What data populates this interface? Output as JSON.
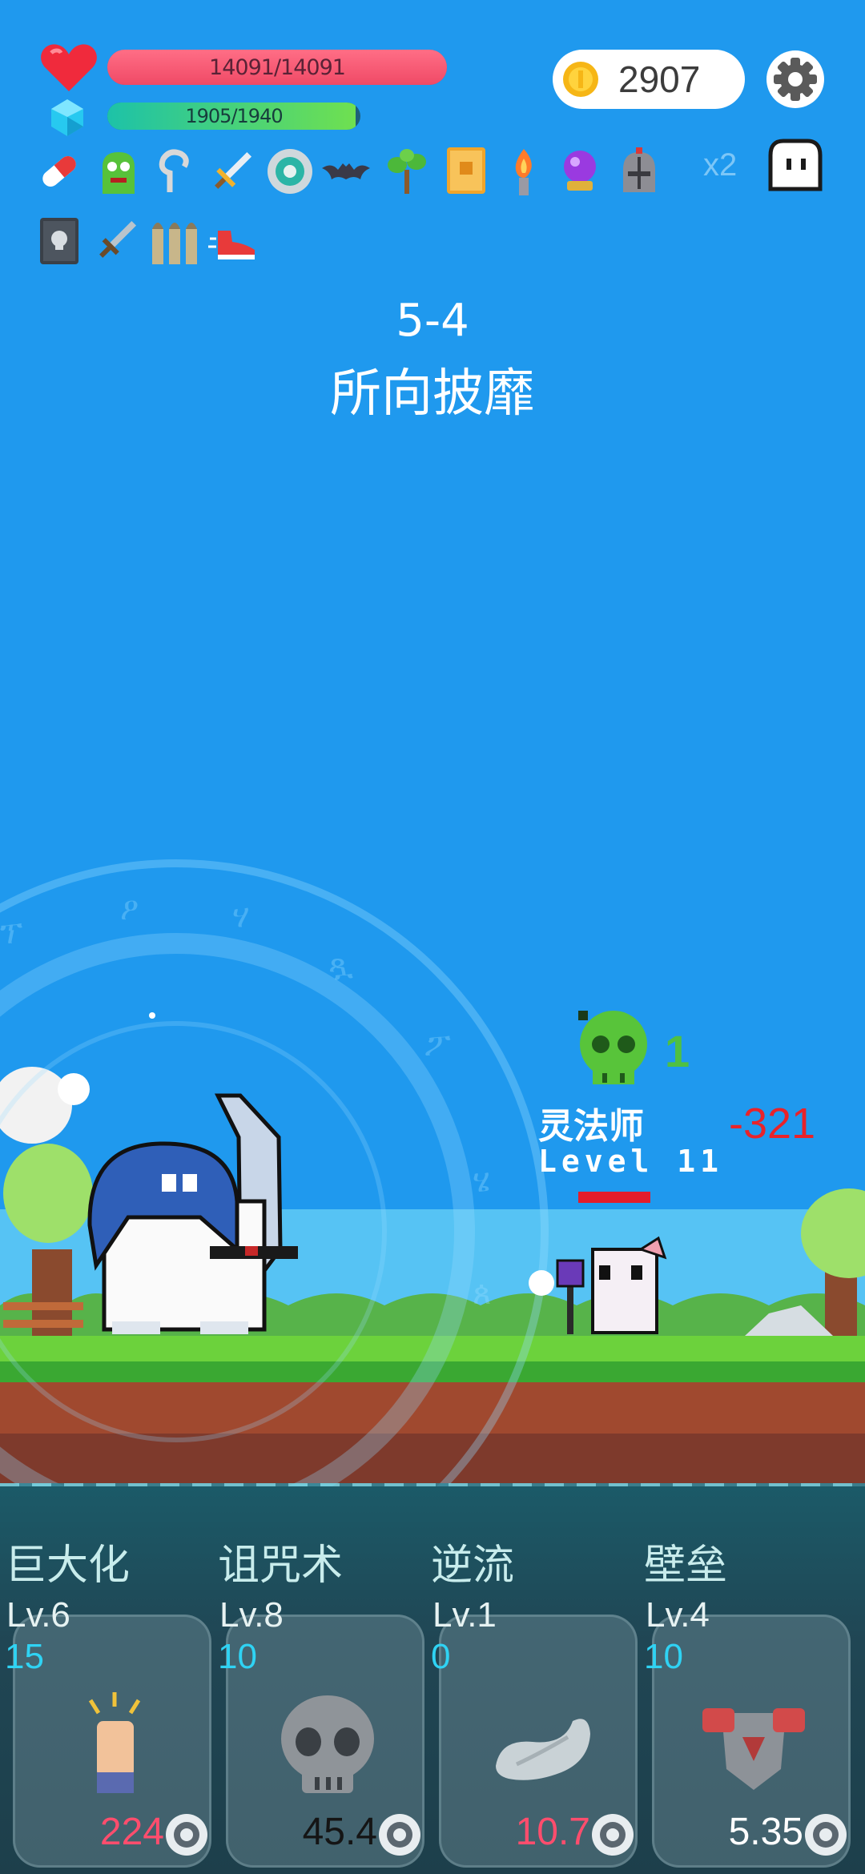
{
  "hud": {
    "hp_text": "14091/14091",
    "hp_fraction": 1.0,
    "mp_text": "1905/1940",
    "mp_fraction": 0.982,
    "coins": "2907",
    "multiplier": "x2",
    "hp_color": "#f04a66",
    "mp_color": "#6fe050"
  },
  "items": [
    {
      "icon": "pill-icon"
    },
    {
      "icon": "green-monster-icon"
    },
    {
      "icon": "hook-icon"
    },
    {
      "icon": "sword-icon"
    },
    {
      "icon": "shield-ring-icon"
    },
    {
      "icon": "bat-icon"
    },
    {
      "icon": "sapling-icon"
    },
    {
      "icon": "spellbook-icon"
    },
    {
      "icon": "torch-icon"
    },
    {
      "icon": "crystal-ball-icon"
    },
    {
      "icon": "helmet-icon"
    },
    {
      "icon": "skull-book-icon"
    },
    {
      "icon": "dagger-icon"
    },
    {
      "icon": "bullets-icon"
    },
    {
      "icon": "sneaker-icon"
    }
  ],
  "stage": {
    "number": "5-4",
    "title": "所向披靡"
  },
  "enemy": {
    "name": "灵法师",
    "level": "Level 11",
    "damage": "-321",
    "kill_count": "1",
    "hp_fraction": 1.0
  },
  "skills": [
    {
      "name": "巨大化",
      "level": "Lv.6",
      "cost": "15",
      "value": "224",
      "value_color": "#ff4d6d",
      "icon": "fist-icon"
    },
    {
      "name": "诅咒术",
      "level": "Lv.8",
      "cost": "10",
      "value": "45.4",
      "value_color": "#151515",
      "icon": "skull-icon"
    },
    {
      "name": "逆流",
      "level": "Lv.1",
      "cost": "0",
      "value": "10.7",
      "value_color": "#ff4d6d",
      "icon": "wind-icon"
    },
    {
      "name": "壁垒",
      "level": "Lv.4",
      "cost": "10",
      "value": "5.35",
      "value_color": "#ffffff",
      "icon": "armor-icon"
    }
  ]
}
